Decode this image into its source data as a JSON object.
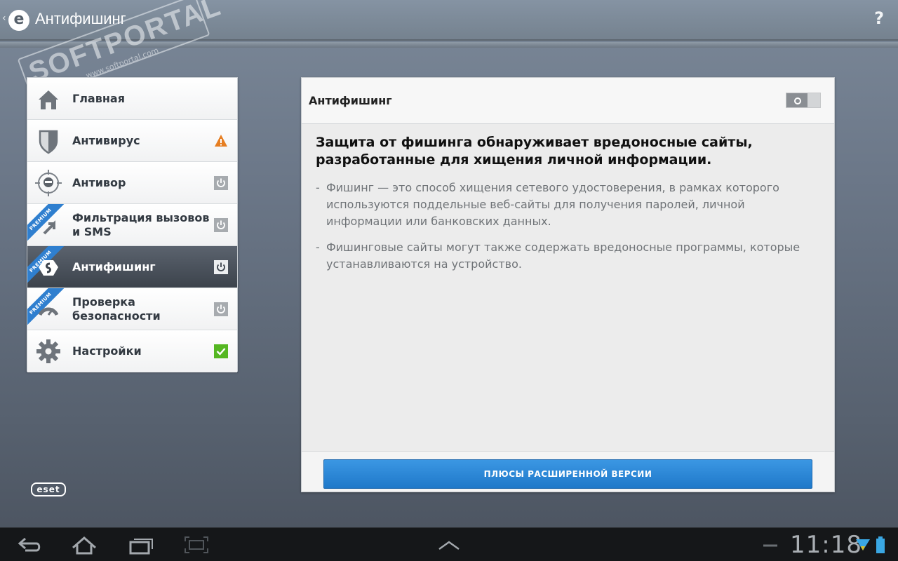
{
  "app": {
    "title": "Антифишинг",
    "help_label": "?",
    "back_glyph": "‹",
    "logo_letter": "e"
  },
  "watermark": {
    "brand": "SOFTPORTAL",
    "url": "www.softportal.com",
    "tm": "™"
  },
  "sidebar": {
    "items": [
      {
        "label": "Главная",
        "icon": "home-icon",
        "status": "none",
        "premium": false,
        "active": false
      },
      {
        "label": "Антивирус",
        "icon": "shield-icon",
        "status": "warning",
        "premium": false,
        "active": false
      },
      {
        "label": "Антивор",
        "icon": "target-icon",
        "status": "power",
        "premium": false,
        "active": false
      },
      {
        "label": "Фильтрация вызовов и SMS",
        "icon": "call-filter-icon",
        "status": "power",
        "premium": true,
        "active": false
      },
      {
        "label": "Антифишинг",
        "icon": "antiphishing-icon",
        "status": "power",
        "premium": true,
        "active": true
      },
      {
        "label": "Проверка безопасности",
        "icon": "gauge-icon",
        "status": "power",
        "premium": true,
        "active": false
      },
      {
        "label": "Настройки",
        "icon": "gear-icon",
        "status": "check",
        "premium": false,
        "active": false
      }
    ],
    "premium_label": "PREMIUM"
  },
  "brand_logo": "eset",
  "panel": {
    "title": "Антифишинг",
    "toggle_state": "off",
    "heading": "Защита от фишинга обнаруживает вредоносные сайты, разработанные для хищения личной информации.",
    "bullets": [
      "Фишинг — это способ хищения сетевого удостоверения, в рамках которого используются поддельные веб-сайты для получения паролей, личной информации или банковских данных.",
      "Фишинговые сайты могут также содержать вредоносные программы, которые устанавливаются на устройство."
    ],
    "upgrade_button": "ПЛЮСЫ РАСШИРЕННОЙ ВЕРСИИ"
  },
  "systembar": {
    "clock": "11:18",
    "buttons": [
      "back-icon",
      "home-icon",
      "recent-apps-icon",
      "screenshot-icon",
      "chevron-up-icon"
    ]
  },
  "colors": {
    "accent_blue": "#1f78c9",
    "warning_orange": "#e67e22",
    "check_green": "#55b722",
    "active_item": "#3c434c"
  }
}
